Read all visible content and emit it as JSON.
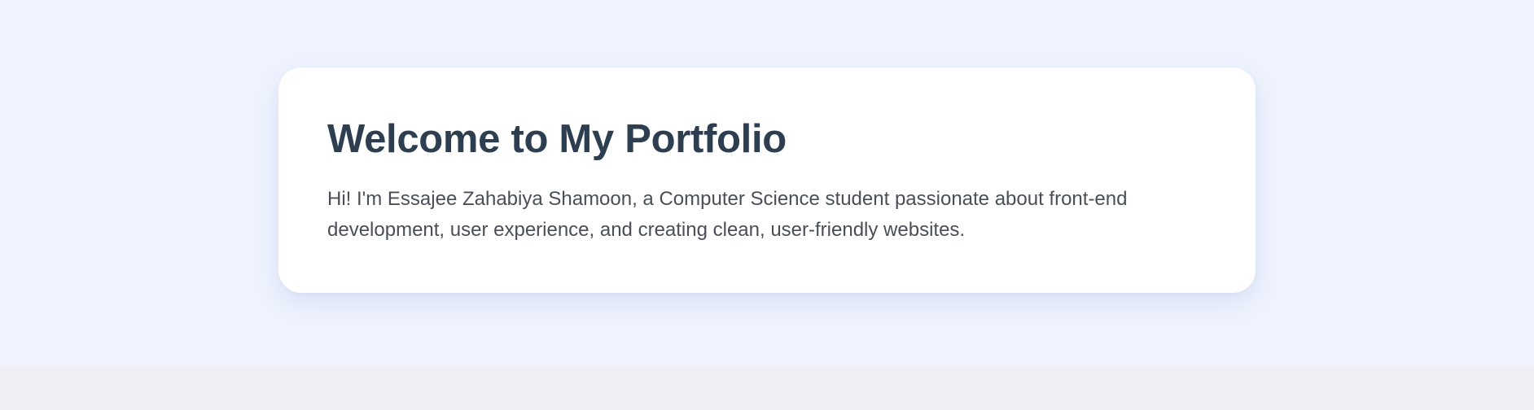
{
  "colors": {
    "page_background": "#eef3fe",
    "lower_band": "#eef0f5",
    "card_background": "#ffffff",
    "title": "#2c3e50",
    "body_text": "#4a4f57"
  },
  "hero": {
    "title": "Welcome to My Portfolio",
    "intro": "Hi! I'm Essajee Zahabiya Shamoon, a Computer Science student passionate about front-end development, user experience, and creating clean, user-friendly websites."
  }
}
